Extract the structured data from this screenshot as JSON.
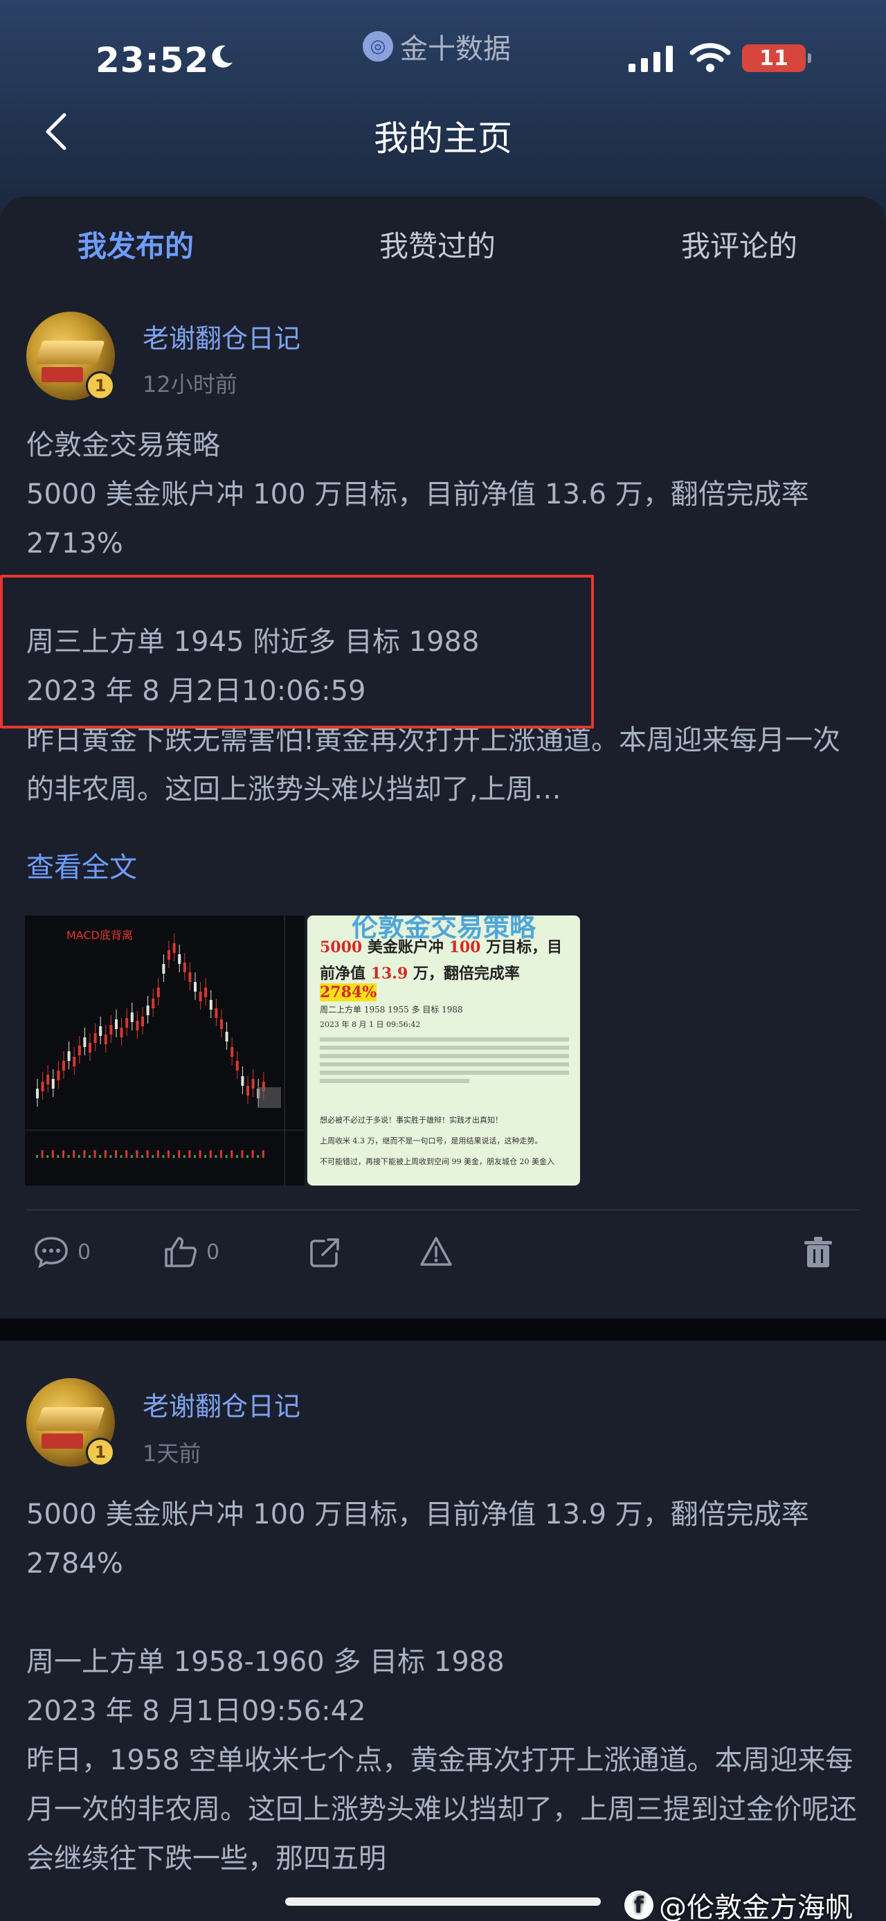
{
  "status_bar": {
    "time": "23:52",
    "source_app": "金十数据",
    "battery": "11"
  },
  "nav": {
    "title": "我的主页"
  },
  "tabs": [
    {
      "label": "我发布的",
      "active": true
    },
    {
      "label": "我赞过的",
      "active": false
    },
    {
      "label": "我评论的",
      "active": false
    }
  ],
  "posts": [
    {
      "author": "老谢翻仓日记",
      "time": "12小时前",
      "badge": "1",
      "text": "伦敦金交易策略\n5000 美金账户冲 100 万目标，目前净值 13.6 万，翻倍完成率 2713%\n\n周三上方单 1945 附近多 目标 1988\n2023 年 8 月2日10:06:59\n昨日黄金下跌无需害怕!黄金再次打开上涨通道。本周迎来每月一次的非农周。这回上涨势头难以挡却了,上周…",
      "view_full": "查看全文",
      "chart_thumb_label": "MACD底背离",
      "strategy_thumb": {
        "title": "伦敦金交易策略",
        "line1_a": "5000",
        "line1_b": " 美金账户冲 ",
        "line1_c": "100",
        "line1_d": " 万目标，目",
        "line2_a": "前净值 ",
        "line2_b": "13.9",
        "line2_c": " 万，翻倍完成率 ",
        "line2_d": "2784%",
        "small1": "周二上方单   1958  1955 多    目标 1988",
        "small2": "2023 年 8 月 1 日 09:56:42",
        "small3": "想必被不必过于多说！事实胜于雄辩！实践才出真知！",
        "small4": "上周收米 4.3 万，继而不是一句口号，是用结果说话，这种走势。",
        "small5": "不可能错过，再接下能被上周收到空间 99 美金，朋友城仓 20 美金入"
      },
      "actions": {
        "comments": "0",
        "likes": "0"
      }
    },
    {
      "author": "老谢翻仓日记",
      "time": "1天前",
      "badge": "1",
      "text": "5000 美金账户冲 100 万目标，目前净值 13.9 万，翻倍完成率 2784%\n\n周一上方单 1958-1960 多 目标 1988\n2023 年 8 月1日09:56:42\n昨日，1958 空单收米七个点，黄金再次打开上涨通道。本周迎来每月一次的非农周。这回上涨势头难以挡却了，上周三提到过金价呢还会继续往下跌一些，那四五明"
    }
  ],
  "watermark": "@伦敦金方海帆"
}
